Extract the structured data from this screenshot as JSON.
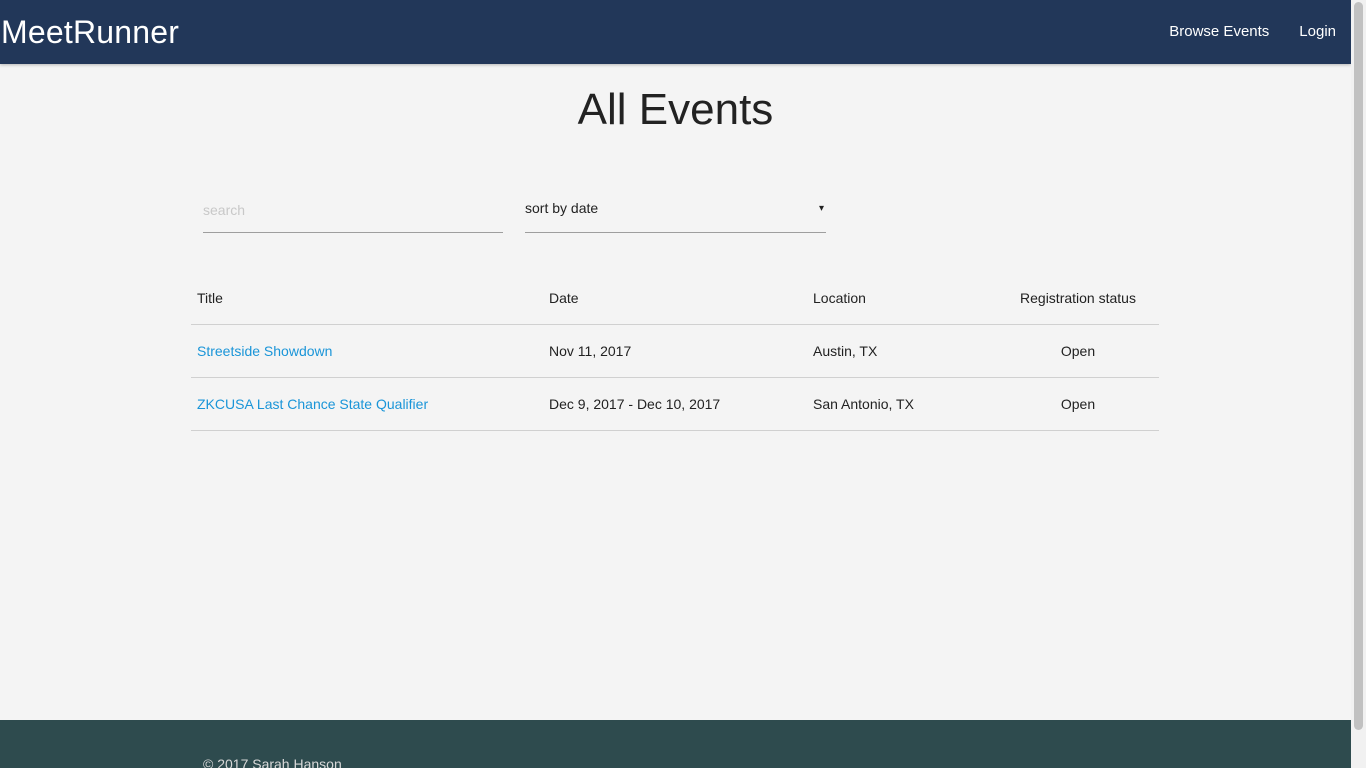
{
  "navbar": {
    "brand": "MeetRunner",
    "links": [
      "Browse Events",
      "Login"
    ]
  },
  "page": {
    "title": "All Events"
  },
  "controls": {
    "search_placeholder": "search",
    "search_value": "",
    "sort_selected": "sort by date",
    "sort_caret": "▾"
  },
  "table": {
    "headers": [
      "Title",
      "Date",
      "Location",
      "Registration status"
    ],
    "rows": [
      {
        "title": "Streetside Showdown",
        "date": "Nov 11, 2017",
        "location": "Austin, TX",
        "status": "Open"
      },
      {
        "title": "ZKCUSA Last Chance State Qualifier",
        "date": "Dec 9, 2017 - Dec 10, 2017",
        "location": "San Antonio, TX",
        "status": "Open"
      }
    ]
  },
  "footer": {
    "copyright": "© 2017 Sarah Hanson"
  },
  "colors": {
    "navbar": "#223759",
    "footer": "#2e4b4e",
    "link": "#1a95d8",
    "background": "#f4f4f4"
  }
}
